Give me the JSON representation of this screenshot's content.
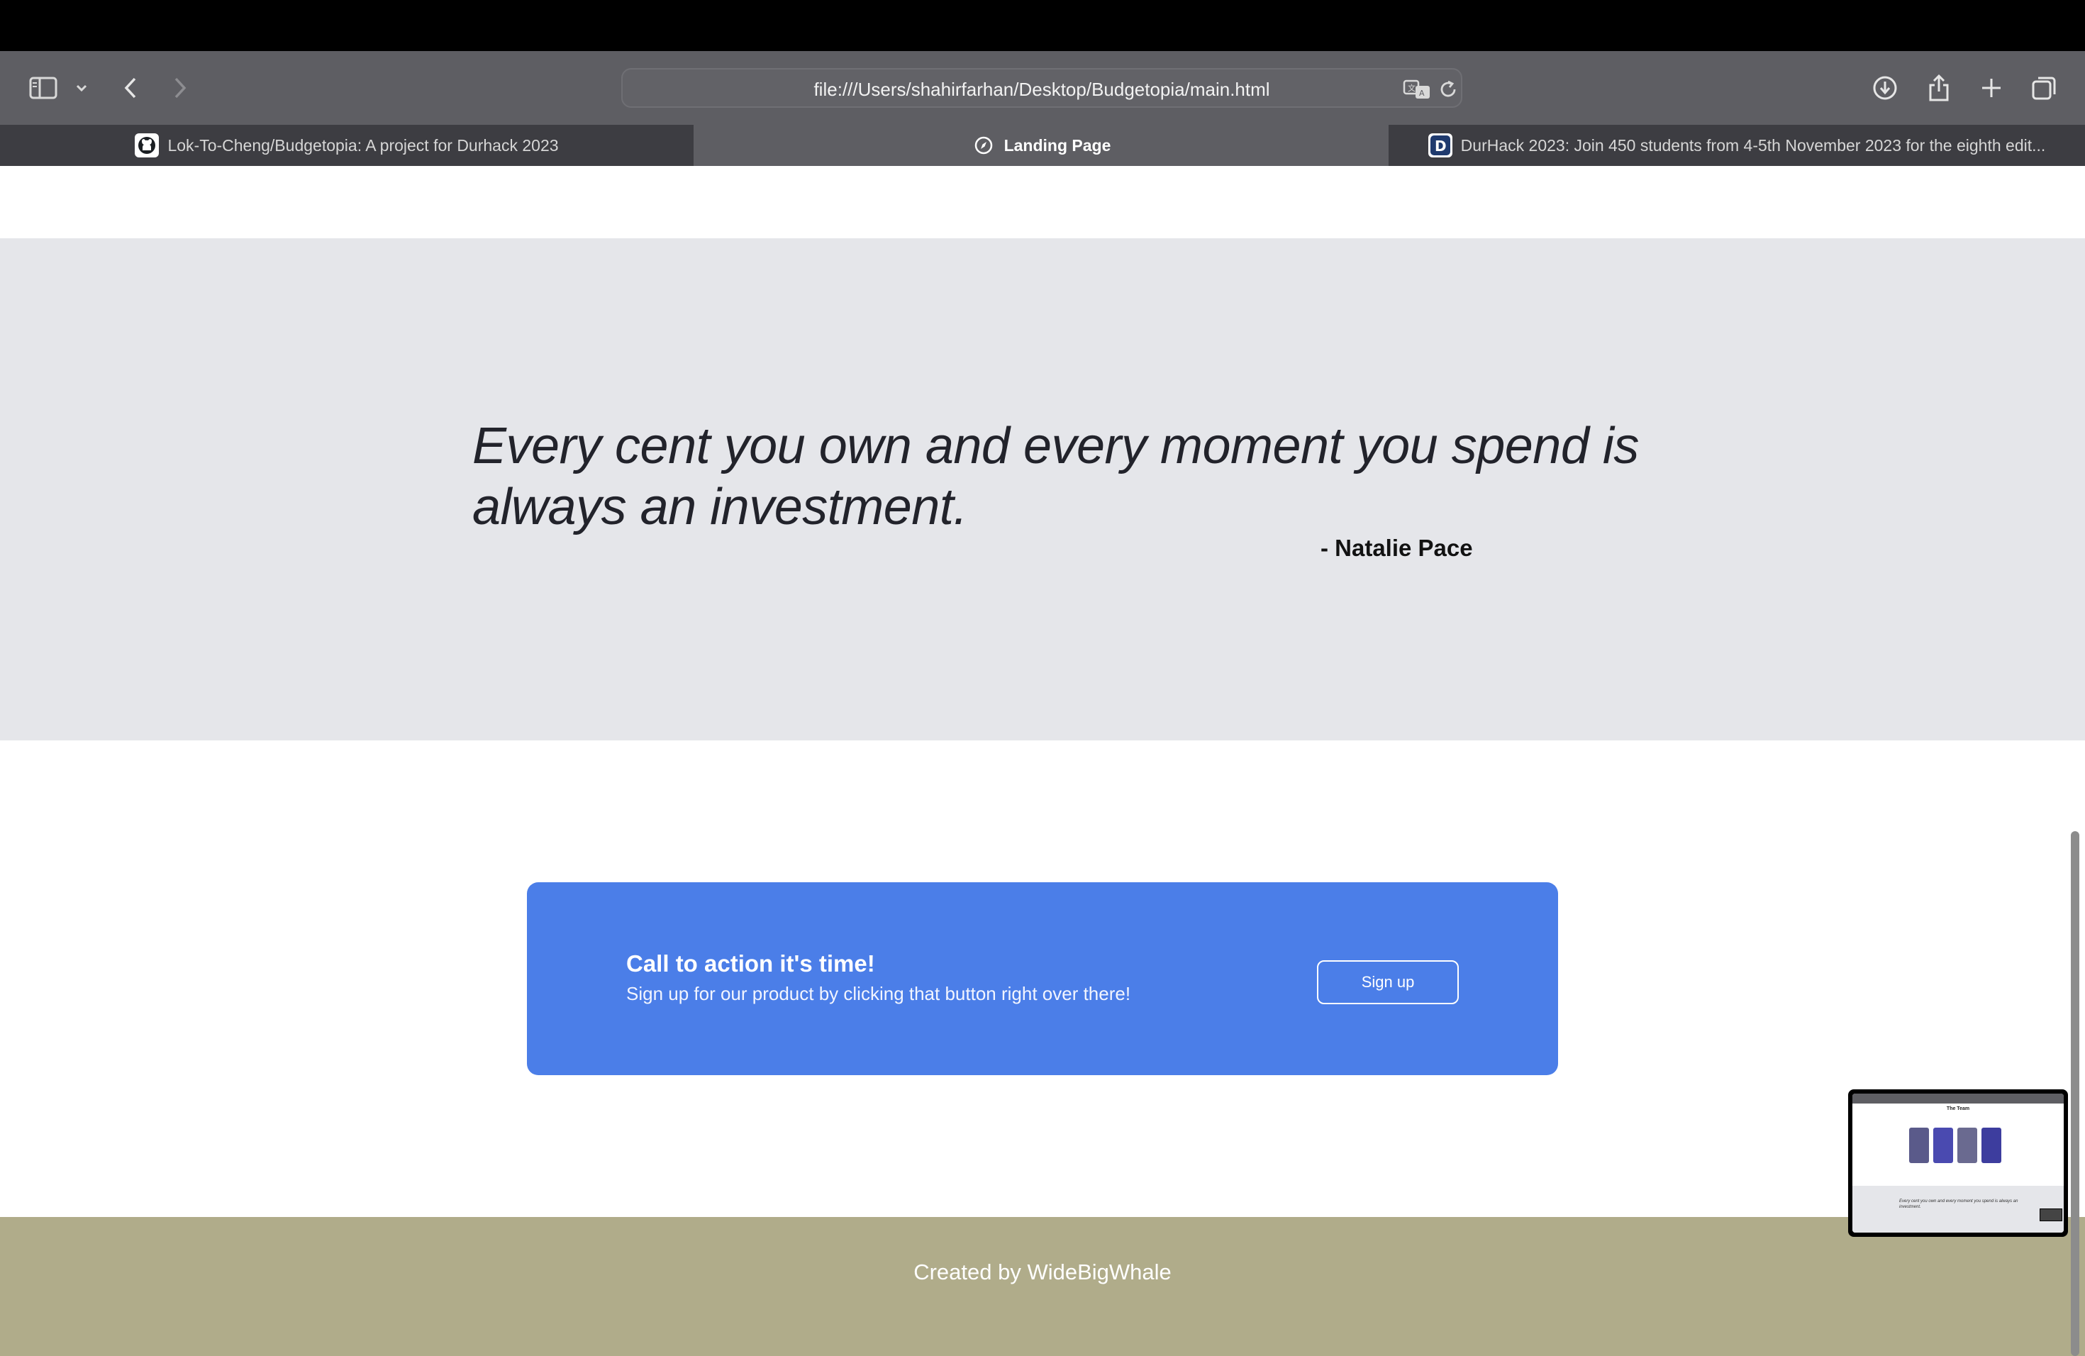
{
  "browser": {
    "address": "file:///Users/shahirfarhan/Desktop/Budgetopia/main.html",
    "tabs": [
      {
        "label": "Lok-To-Cheng/Budgetopia: A project for Durhack 2023",
        "icon": "github-icon",
        "active": false
      },
      {
        "label": "Landing Page",
        "icon": "compass-icon",
        "active": true
      },
      {
        "label": "DurHack 2023: Join 450 students from 4-5th November 2023 for the eighth edit...",
        "icon": "durhack-d-icon",
        "active": false
      }
    ],
    "toolbar_icons": [
      "sidebar-icon",
      "chevron-down-icon",
      "back-icon",
      "forward-icon",
      "translate-icon",
      "reload-icon",
      "download-icon",
      "share-icon",
      "new-tab-icon",
      "tab-overview-icon"
    ]
  },
  "quote": {
    "text": "Every cent you own and every moment you spend is always an investment.",
    "author": "- Natalie Pace"
  },
  "cta": {
    "title": "Call to action it's time!",
    "subtitle": "Sign up for our product by clicking that button right over there!",
    "button_label": "Sign up",
    "background_color": "#4b7ee8"
  },
  "footer": {
    "text": "Created by WideBigWhale",
    "background_color": "#b0ac8a"
  },
  "preview": {
    "title": "The Team",
    "quote": "Every cent you own and every moment you spend is always an investment."
  }
}
